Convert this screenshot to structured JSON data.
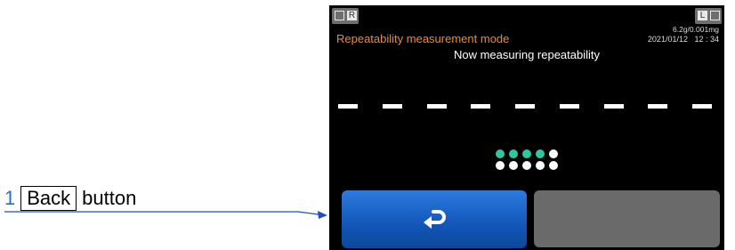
{
  "callout": {
    "number": "1",
    "name": "Back",
    "suffix": "button"
  },
  "screen": {
    "left_chip_label": "R",
    "right_chip_label": "L",
    "mode_title": "Repeatability measurement mode",
    "status": "Now measuring repeatability",
    "capacity": "6.2g/0.001mg",
    "datetime": "2021/01/12   12 : 34",
    "dash_count": 9,
    "progress_dots_top": [
      "on",
      "on",
      "on",
      "on",
      "off"
    ],
    "progress_dots_bottom": [
      "off",
      "off",
      "off",
      "off",
      "off"
    ],
    "back_icon": "return-arrow-icon"
  },
  "colors": {
    "mode_title": "#e8893a",
    "active_dot": "#2ec7a2",
    "back_button": "#1f64c8",
    "disabled_button": "#6a6a6a",
    "callout_number": "#1f6fd1"
  }
}
